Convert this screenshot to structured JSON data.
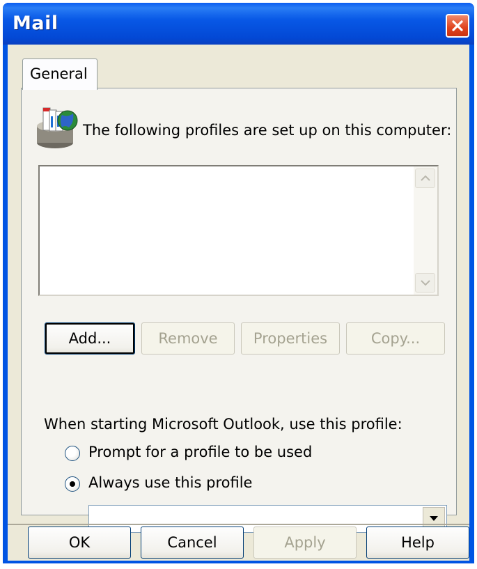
{
  "window": {
    "title": "Mail"
  },
  "tabs": [
    {
      "label": "General",
      "selected": true
    }
  ],
  "profiles": {
    "label": "The following profiles are set up on this computer:",
    "items": []
  },
  "profile_buttons": {
    "add": "Add...",
    "remove": "Remove",
    "properties": "Properties",
    "copy": "Copy..."
  },
  "startup": {
    "label": "When starting Microsoft Outlook, use this profile:",
    "options": [
      {
        "label": "Prompt for a profile to be used",
        "selected": false
      },
      {
        "label": "Always use this profile",
        "selected": true
      }
    ],
    "profile_select_value": ""
  },
  "dialog_buttons": {
    "ok": "OK",
    "cancel": "Cancel",
    "apply": "Apply",
    "help": "Help"
  },
  "icons": {
    "close": "close-icon",
    "profiles": "mail-profiles-icon",
    "scroll_up": "scroll-up-arrow-icon",
    "scroll_down": "scroll-down-arrow-icon",
    "dropdown": "chevron-down-icon"
  },
  "colors": {
    "titlebar": "#0054e3",
    "face": "#ece9d8",
    "close": "#e0431e",
    "button_border": "#003c74"
  }
}
